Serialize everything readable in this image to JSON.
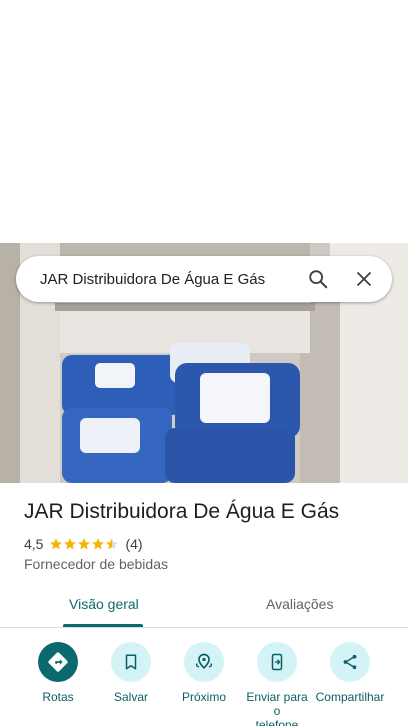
{
  "search": {
    "query": "JAR Distribuidora De Água E Gás"
  },
  "place": {
    "title": "JAR Distribuidora De Água E Gás",
    "rating": "4,5",
    "rating_value": 4.5,
    "review_count": "(4)",
    "category": "Fornecedor de bebidas"
  },
  "tabs": [
    {
      "label": "Visão geral",
      "selected": true
    },
    {
      "label": "Avaliações",
      "selected": false
    }
  ],
  "actions": [
    {
      "label": "Rotas",
      "icon": "directions-icon"
    },
    {
      "label": "Salvar",
      "icon": "bookmark-icon"
    },
    {
      "label": "Próximo",
      "icon": "nearby-icon"
    },
    {
      "label": "Enviar para o\ntelefone",
      "icon": "send-to-phone-icon"
    },
    {
      "label": "Compartilhar",
      "icon": "share-icon"
    }
  ],
  "colors": {
    "accent": "#0b6a70",
    "action_bg": "#d4f3f7",
    "star": "#f4b400"
  }
}
